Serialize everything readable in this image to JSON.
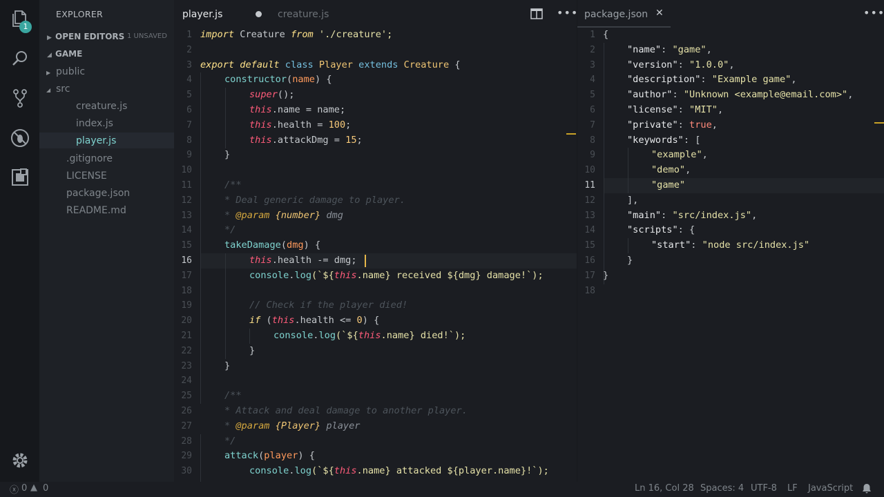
{
  "activity": {
    "explorer_badge": "1"
  },
  "sidebar": {
    "title": "EXPLORER",
    "open_editors": "OPEN EDITORS",
    "unsaved": "1 UNSAVED",
    "project": "GAME",
    "tree": [
      {
        "label": "public",
        "type": "folder-collapsed"
      },
      {
        "label": "src",
        "type": "folder-open"
      },
      {
        "label": "creature.js",
        "type": "file"
      },
      {
        "label": "index.js",
        "type": "file"
      },
      {
        "label": "player.js",
        "type": "file-active"
      },
      {
        "label": ".gitignore",
        "type": "file"
      },
      {
        "label": "LICENSE",
        "type": "file"
      },
      {
        "label": "package.json",
        "type": "file"
      },
      {
        "label": "README.md",
        "type": "file"
      }
    ]
  },
  "left_editor": {
    "tabs": [
      "player.js",
      "creature.js"
    ],
    "line_numbers": [
      "1",
      "2",
      "3",
      "4",
      "5",
      "6",
      "7",
      "8",
      "9",
      "10",
      "11",
      "12",
      "13",
      "14",
      "15",
      "16",
      "17",
      "18",
      "19",
      "20",
      "21",
      "22",
      "23",
      "24",
      "25",
      "26",
      "27",
      "28",
      "29",
      "30"
    ],
    "code": {
      "l1": [
        "import",
        " Creature ",
        "from",
        " './creature';"
      ],
      "l3": [
        "export default",
        " class ",
        "Player",
        " extends ",
        "Creature",
        " {"
      ],
      "l4": [
        "constructor",
        "(",
        "name",
        ") {"
      ],
      "l5": [
        "super",
        "();"
      ],
      "l6": [
        "this",
        ".name = name;"
      ],
      "l7": [
        "this",
        ".health = ",
        "100",
        ";"
      ],
      "l8": [
        "this",
        ".attackDmg = ",
        "15",
        ";"
      ],
      "l9": "}",
      "l11": "/**",
      "l12": "* Deal generic damage to player.",
      "l13": [
        "* ",
        "@param",
        " {number}",
        " dmg"
      ],
      "l14": "*/",
      "l15": [
        "takeDamage",
        "(",
        "dmg",
        ") {"
      ],
      "l16": [
        "this",
        ".health -= dmg;"
      ],
      "l17": [
        "console",
        ".",
        "log",
        "(`${",
        "this",
        ".name} received ${dmg} damage!`);"
      ],
      "l19": "// Check if the player died!",
      "l20": [
        "if",
        " (",
        "this",
        ".health <= ",
        "0",
        ") {"
      ],
      "l21": [
        "console",
        ".",
        "log",
        "(`${",
        "this",
        ".name} died!`);"
      ],
      "l22": "}",
      "l23": "}",
      "l25": "/**",
      "l26": "* Attack and deal damage to another player.",
      "l27": [
        "* ",
        "@param",
        " {Player}",
        " player"
      ],
      "l28": "*/",
      "l29": [
        "attack",
        "(",
        "player",
        ") {"
      ],
      "l30": [
        "console",
        ".",
        "log",
        "(`${",
        "this",
        ".name} attacked ${player.name}!`);"
      ]
    }
  },
  "right_editor": {
    "tab": "package.json",
    "line_numbers": [
      "1",
      "2",
      "3",
      "4",
      "5",
      "6",
      "7",
      "8",
      "9",
      "10",
      "11",
      "12",
      "13",
      "14",
      "15",
      "16",
      "17",
      "18"
    ],
    "code": {
      "r1": "{",
      "r2": [
        "\"name\"",
        ": ",
        "\"game\"",
        ","
      ],
      "r3": [
        "\"version\"",
        ": ",
        "\"1.0.0\"",
        ","
      ],
      "r4": [
        "\"description\"",
        ": ",
        "\"Example game\"",
        ","
      ],
      "r5": [
        "\"author\"",
        ": ",
        "\"Unknown <example@email.com>\"",
        ","
      ],
      "r6": [
        "\"license\"",
        ": ",
        "\"MIT\"",
        ","
      ],
      "r7": [
        "\"private\"",
        ": ",
        "true",
        ","
      ],
      "r8": [
        "\"keywords\"",
        ": ["
      ],
      "r9": [
        "\"example\"",
        ","
      ],
      "r10": [
        "\"demo\"",
        ","
      ],
      "r11": "\"game\"",
      "r12": "],",
      "r13": [
        "\"main\"",
        ": ",
        "\"src/index.js\"",
        ","
      ],
      "r14": [
        "\"scripts\"",
        ": {"
      ],
      "r15": [
        "\"start\"",
        ": ",
        "\"node src/index.js\""
      ],
      "r16": "}",
      "r17": "}"
    }
  },
  "status": {
    "errors": "0",
    "warnings": "0",
    "position": "Ln 16, Col 28",
    "spaces": "Spaces: 4",
    "encoding": "UTF-8",
    "eol": "LF",
    "language": "JavaScript"
  }
}
